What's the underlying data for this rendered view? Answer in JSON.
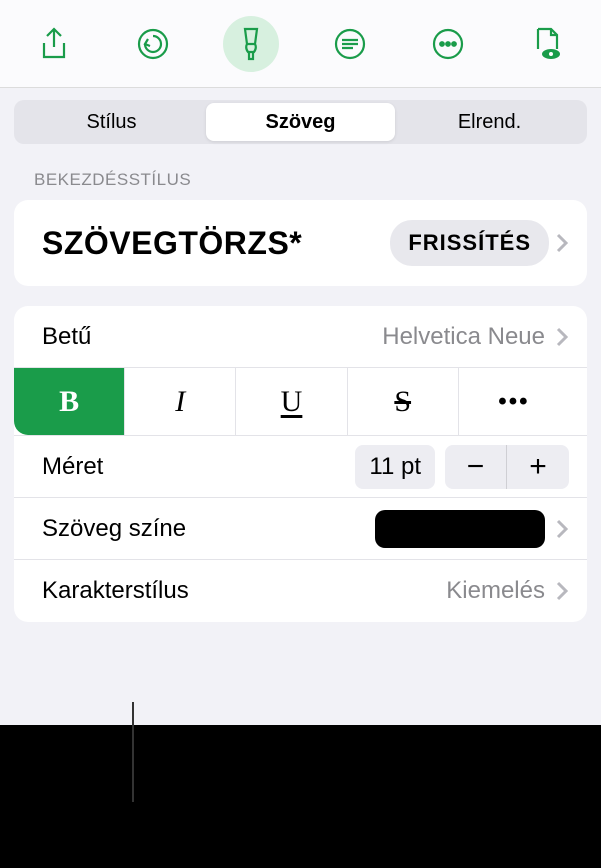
{
  "toolbar": {
    "share": "share-icon",
    "undo": "undo-icon",
    "format": "paintbrush-icon",
    "insert": "text-lines-icon",
    "more": "more-icon",
    "document": "document-eye-icon"
  },
  "tabs": {
    "style": "Stílus",
    "text": "Szöveg",
    "layout": "Elrend."
  },
  "section_header": "BEKEZDÉSSTÍLUS",
  "paragraph_style": {
    "name": "SZÖVEGTÖRZS*",
    "update_label": "FRISSÍTÉS"
  },
  "rows": {
    "font_label": "Betű",
    "font_value": "Helvetica Neue",
    "size_label": "Méret",
    "size_value": "11 pt",
    "color_label": "Szöveg színe",
    "color_value": "#000000",
    "charstyle_label": "Karakterstílus",
    "charstyle_value": "Kiemelés"
  },
  "format_buttons": {
    "bold": "B",
    "italic": "I",
    "underline": "U",
    "strike": "S",
    "more": "•••"
  },
  "stepper": {
    "minus": "−",
    "plus": "+"
  }
}
